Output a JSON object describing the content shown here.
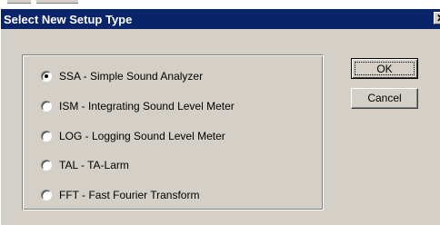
{
  "window": {
    "title": "Select New Setup Type",
    "close_glyph": "✕"
  },
  "options": [
    {
      "label": "SSA - Simple Sound Analyzer",
      "checked": true
    },
    {
      "label": "ISM - Integrating Sound Level Meter",
      "checked": false
    },
    {
      "label": "LOG - Logging Sound Level Meter",
      "checked": false
    },
    {
      "label": "TAL - TA-Larm",
      "checked": false
    },
    {
      "label": "FFT - Fast Fourier Transform",
      "checked": false
    }
  ],
  "buttons": {
    "ok": "OK",
    "cancel": "Cancel"
  },
  "colors": {
    "titlebar": "#0a246a",
    "face": "#d4d0c8"
  }
}
